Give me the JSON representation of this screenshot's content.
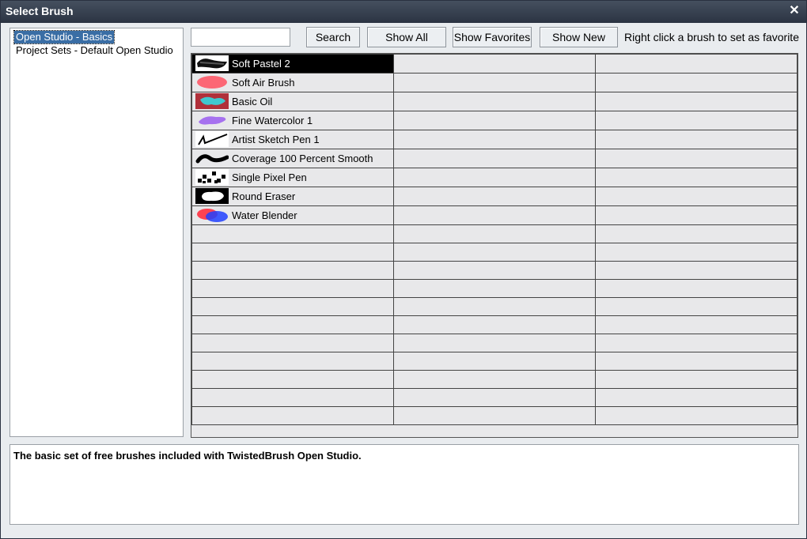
{
  "window": {
    "title": "Select Brush"
  },
  "sets": {
    "items": [
      {
        "label": "Open Studio - Basics",
        "selected": true
      },
      {
        "label": "Project Sets - Default Open Studio",
        "selected": false
      }
    ]
  },
  "toolbar": {
    "search_value": "",
    "search_label": "Search",
    "show_all_label": "Show All",
    "show_favorites_label": "Show Favorites",
    "show_new_label": "Show New",
    "hint": "Right click a brush to set as favorite"
  },
  "brushes": [
    {
      "name": "Soft Pastel 2",
      "icon": "soft-pastel-thumb",
      "selected": true
    },
    {
      "name": "Soft Air Brush",
      "icon": "soft-air-brush-thumb"
    },
    {
      "name": "Basic Oil",
      "icon": "basic-oil-thumb"
    },
    {
      "name": "Fine Watercolor 1",
      "icon": "fine-watercolor-thumb"
    },
    {
      "name": "Artist Sketch Pen 1",
      "icon": "sketch-pen-thumb"
    },
    {
      "name": "Coverage 100 Percent Smooth",
      "icon": "coverage-thumb"
    },
    {
      "name": "Single Pixel Pen",
      "icon": "pixel-pen-thumb"
    },
    {
      "name": "Round Eraser",
      "icon": "round-eraser-thumb"
    },
    {
      "name": "Water Blender",
      "icon": "water-blender-thumb"
    }
  ],
  "grid": {
    "columns": 3,
    "rows": 20
  },
  "description": "The basic set of free brushes included with TwistedBrush Open Studio.",
  "colors": {
    "titlebar": "#2b3342",
    "selection": "#3a6ea5",
    "selected_brush_bg": "#000000"
  }
}
